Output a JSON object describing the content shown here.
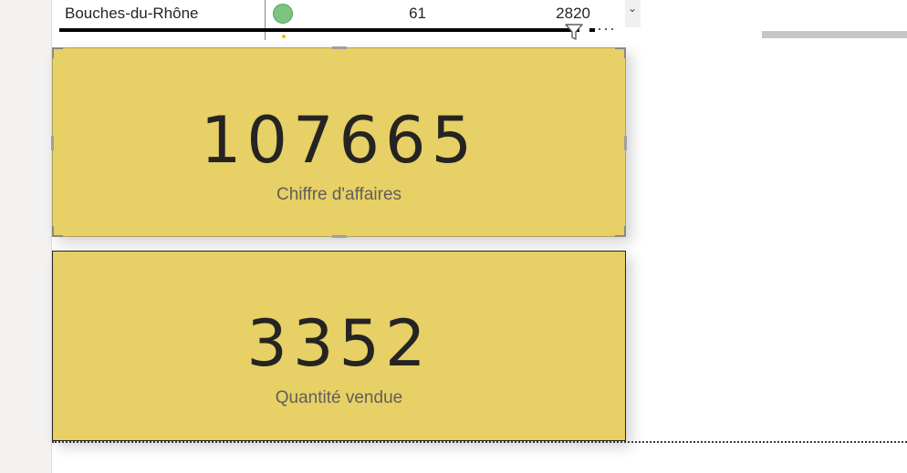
{
  "table": {
    "row": {
      "name": "Bouches-du-Rhône",
      "status_color": "#7cc47f",
      "value_1": "61",
      "value_2": "2820"
    }
  },
  "cards": [
    {
      "value": "107665",
      "label": "Chiffre d'affaires",
      "selected": true
    },
    {
      "value": "3352",
      "label": "Quantité vendue",
      "selected": false
    }
  ],
  "icons": {
    "filter": "filter-icon",
    "more": "more-options-icon",
    "scroll": "chevron-down-icon"
  },
  "glyphs": {
    "more": "···",
    "chevron": "⌄"
  },
  "colors": {
    "card_background": "#e7d065",
    "text_primary": "#252423",
    "text_secondary": "#605e5c"
  }
}
